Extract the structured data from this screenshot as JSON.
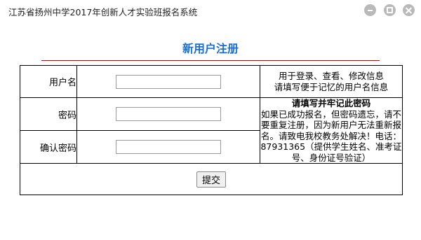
{
  "window": {
    "title": "江苏省扬州中学2017年创新人才实验班报名系统"
  },
  "form": {
    "heading": "新用户注册",
    "fields": [
      {
        "label": "用户名",
        "value": ""
      },
      {
        "label": "密码",
        "value": ""
      },
      {
        "label": "确认密码",
        "value": ""
      }
    ],
    "info_top": {
      "line1": "用于登录、查看、修改信息",
      "line2": "请填写便于记忆的用户名信息"
    },
    "info_password": {
      "title": "请填写并牢记此密码",
      "body": "如果已成功报名，但密码遗忘，请不要重复注册，因为新用户无法重新报名。请致电我校教务处解决！电话：87931365（提供学生姓名、准考证号、身份证号验证）"
    },
    "submit_label": "提交"
  }
}
